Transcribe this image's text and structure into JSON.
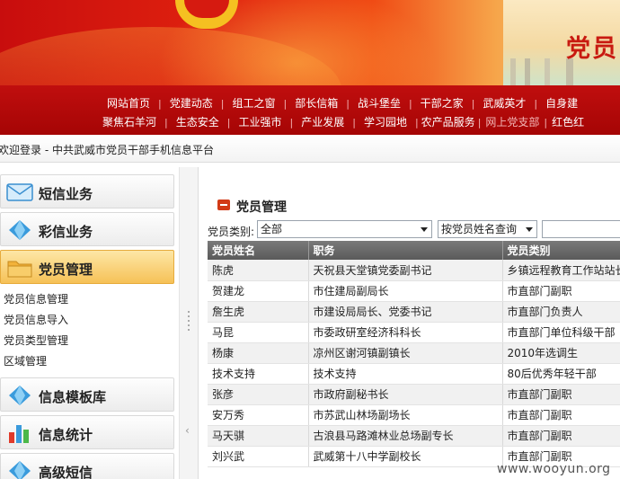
{
  "banner": {
    "brand_text": "党员"
  },
  "nav": {
    "row1": [
      "网站首页",
      "党建动态",
      "组工之窗",
      "部长信箱",
      "战斗堡垒",
      "干部之家",
      "武威英才",
      "自身建"
    ],
    "row2": [
      "聚焦石羊河",
      "生态安全",
      "工业强市",
      "产业发展",
      "学习园地",
      "农产品服务",
      "网上党支部",
      "红色红"
    ]
  },
  "breadcrumb": {
    "text": "欢迎登录 - 中共武威市党员干部手机信息平台"
  },
  "sidebar": {
    "sections": [
      {
        "label": "短信业务",
        "icon": "envelope-icon"
      },
      {
        "label": "彩信业务",
        "icon": "diamond-icon"
      },
      {
        "label": "党员管理",
        "icon": "folder-icon"
      },
      {
        "label": "信息模板库",
        "icon": "diamond-icon"
      },
      {
        "label": "信息统计",
        "icon": "bar-chart-icon"
      },
      {
        "label": "高级短信",
        "icon": "diamond-icon"
      }
    ],
    "sub_items": [
      "党员信息管理",
      "党员信息导入",
      "党员类型管理",
      "区域管理"
    ]
  },
  "main": {
    "title": "党员管理",
    "filter_label": "党员类别:",
    "type_select_value": "全部",
    "mode_select_value": "按党员姓名查询",
    "search_value": ""
  },
  "table": {
    "headers": [
      "党员姓名",
      "职务",
      "党员类别"
    ],
    "rows": [
      [
        "陈虎",
        "天祝县天堂镇党委副书记",
        "乡镇远程教育工作站站长"
      ],
      [
        "贺建龙",
        "市住建局副局长",
        "市直部门副职"
      ],
      [
        "詹生虎",
        "市建设局局长、党委书记",
        "市直部门负责人"
      ],
      [
        "马昆",
        "市委政研室经济科科长",
        "市直部门单位科级干部"
      ],
      [
        "杨康",
        "凉州区谢河镇副镇长",
        "2010年选调生"
      ],
      [
        "技术支持",
        "技术支持",
        "80后优秀年轻干部"
      ],
      [
        "张彦",
        "市政府副秘书长",
        "市直部门副职"
      ],
      [
        "安万秀",
        "市苏武山林场副场长",
        "市直部门副职"
      ],
      [
        "马天骐",
        "古浪县马路滩林业总场副专长",
        "市直部门副职"
      ],
      [
        "刘兴武",
        "武威第十八中学副校长",
        "市直部门副职"
      ]
    ]
  },
  "watermark": "www.wooyun.org"
}
